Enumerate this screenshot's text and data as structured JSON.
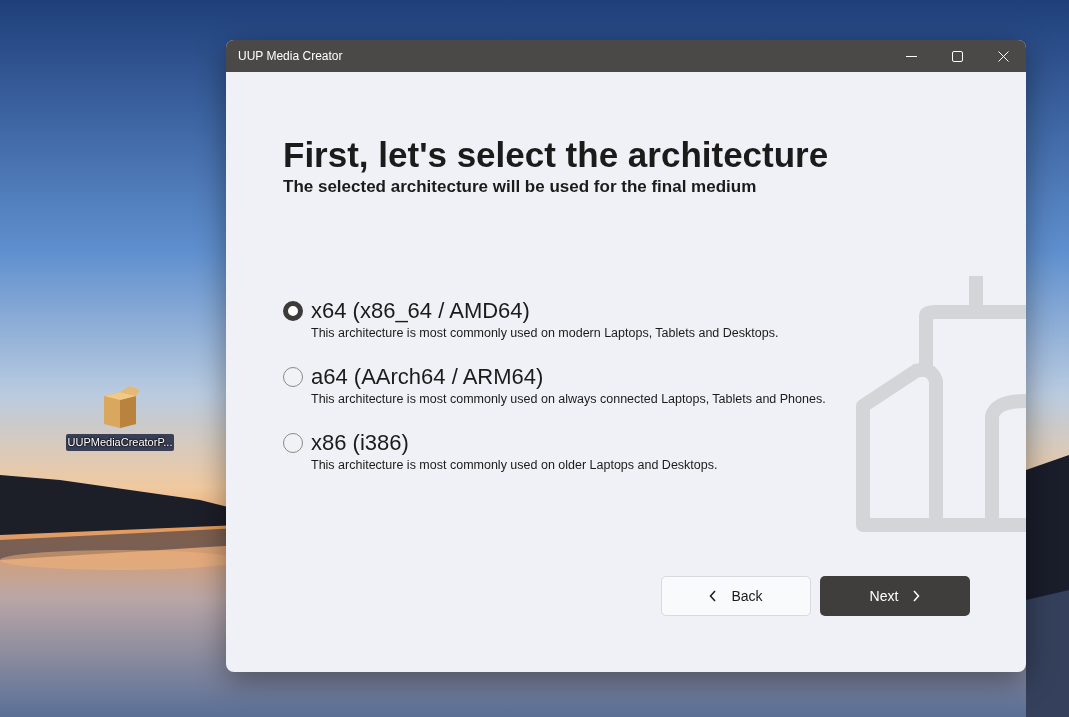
{
  "desktop_icon": {
    "label": "UUPMediaCreatorP..."
  },
  "window": {
    "title": "UUP Media Creator"
  },
  "heading": "First, let's select the architecture",
  "subtitle": "The selected architecture will be used for the final medium",
  "options": [
    {
      "label": "x64 (x86_64 / AMD64)",
      "description": "This architecture is most commonly used on modern Laptops, Tablets and Desktops.",
      "selected": true
    },
    {
      "label": "a64 (AArch64 / ARM64)",
      "description": "This architecture is most commonly used on always connected Laptops, Tablets and Phones.",
      "selected": false
    },
    {
      "label": "x86 (i386)",
      "description": "This architecture is most commonly used on older Laptops and Desktops.",
      "selected": false
    }
  ],
  "buttons": [
    {
      "kind": "back",
      "label": "Back"
    },
    {
      "kind": "next",
      "label": "Next"
    }
  ]
}
